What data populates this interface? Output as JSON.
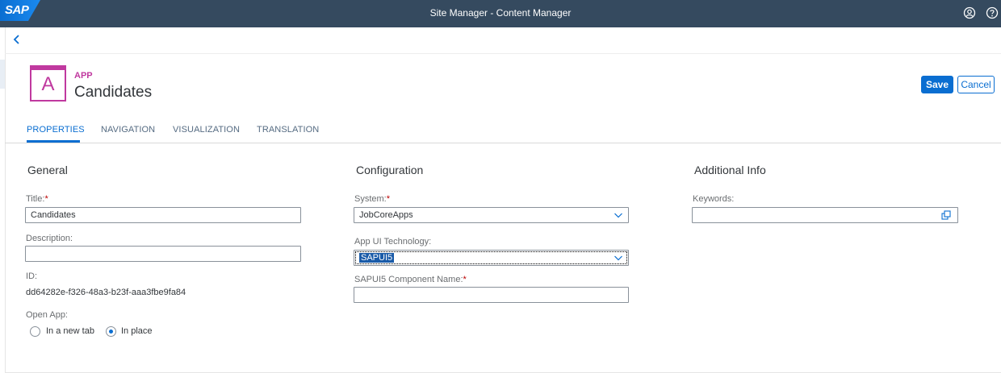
{
  "shell": {
    "logo": "SAP",
    "title": "Site Manager - Content Manager",
    "user_icon": "user-icon",
    "help_icon": "help-icon"
  },
  "header": {
    "back_icon": "chevron-left-icon",
    "app_icon_letter": "A",
    "type_label": "APP",
    "title": "Candidates",
    "save_label": "Save",
    "cancel_label": "Cancel"
  },
  "tabs": [
    {
      "label": "PROPERTIES",
      "active": true
    },
    {
      "label": "NAVIGATION",
      "active": false
    },
    {
      "label": "VISUALIZATION",
      "active": false
    },
    {
      "label": "TRANSLATION",
      "active": false
    }
  ],
  "general": {
    "heading": "General",
    "title_label": "Title:",
    "title_value": "Candidates",
    "description_label": "Description:",
    "description_value": "",
    "id_label": "ID:",
    "id_value": "dd64282e-f326-48a3-b23f-aaa3fbe9fa84",
    "open_app_label": "Open App:",
    "open_options": [
      "In a new tab",
      "In place"
    ],
    "open_selected": "In place"
  },
  "configuration": {
    "heading": "Configuration",
    "system_label": "System:",
    "system_value": "JobCoreApps",
    "tech_label": "App UI Technology:",
    "tech_value": "SAPUI5",
    "component_label": "SAPUI5 Component Name:",
    "component_value": ""
  },
  "additional": {
    "heading": "Additional Info",
    "keywords_label": "Keywords:",
    "keywords_value": ""
  },
  "required_marker": "*",
  "colors": {
    "shell": "#354a5f",
    "accent": "#0a6ed1",
    "app_icon": "#c0399f",
    "required": "#bb0000"
  }
}
